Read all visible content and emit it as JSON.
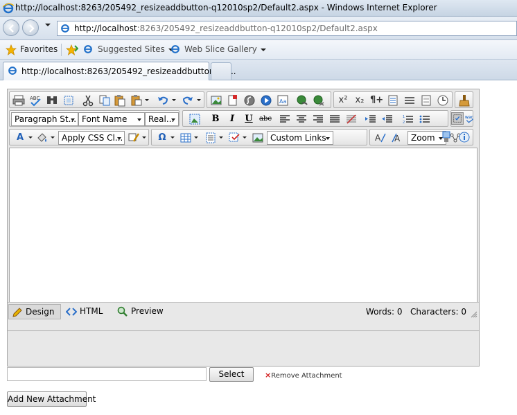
{
  "browser": {
    "window_title": "http://localhost:8263/205492_resizeaddbutton-q12010sp2/Default2.aspx - Windows Internet Explorer",
    "address_host": "http://localhost",
    "address_path": ":8263/205492_resizeaddbutton-q12010sp2/Default2.aspx",
    "favorites_label": "Favorites",
    "suggested_sites_label": "Suggested Sites",
    "web_slice_gallery_label": "Web Slice Gallery",
    "tab_title": "http://localhost:8263/205492_resizeaddbutton-q1..."
  },
  "editor": {
    "toolbar": {
      "paragraph_style": "Paragraph St...",
      "font_name": "Font Name",
      "font_size": "Real...",
      "apply_css_class": "Apply CSS Cl...",
      "custom_links": "Custom Links",
      "zoom": "Zoom",
      "bold": "B",
      "italic": "I",
      "underline": "U",
      "strike": "abc",
      "omega": "Ω"
    },
    "modes": {
      "design": "Design",
      "html": "HTML",
      "preview": "Preview"
    },
    "stats": {
      "words_label": "Words:",
      "words": "0",
      "characters_label": "Characters:",
      "characters": "0"
    }
  },
  "attachments": {
    "select_label": "Select",
    "remove_label": "Remove Attachment",
    "remove_x": "×",
    "add_new_label": "Add New Attachment"
  },
  "colors": {
    "accent_blue": "#1f5fb7",
    "remove_red": "#d32020"
  }
}
